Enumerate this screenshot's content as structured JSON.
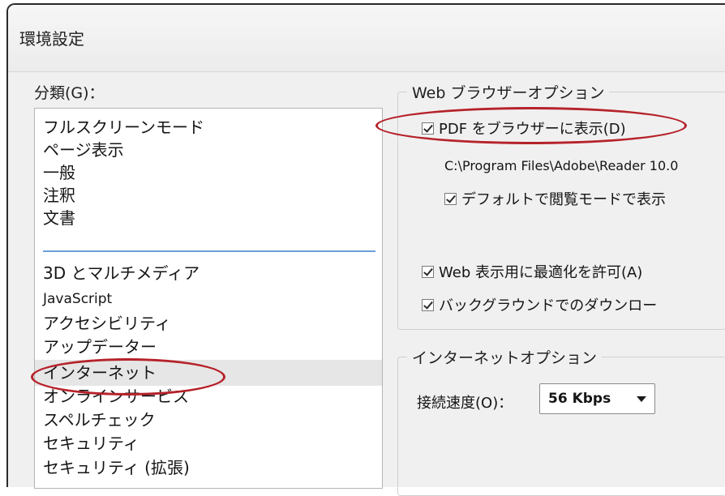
{
  "window": {
    "title": "環境設定"
  },
  "categories": {
    "label": "分類(G)：",
    "top_items": [
      "フルスクリーンモード",
      "ページ表示",
      "一般",
      "注釈",
      "文書"
    ],
    "items": [
      "3D とマルチメディア",
      "JavaScript",
      "アクセシビリティ",
      "アップデーター",
      "インターネット",
      "オンラインサービス",
      "スペルチェック",
      "セキュリティ",
      "セキュリティ (拡張)"
    ],
    "selected": "インターネット"
  },
  "web_browser_options": {
    "title": "Web ブラウザーオプション",
    "display_pdf_in_browser": {
      "label": "PDF をブラウザーに表示(D)",
      "checked": true
    },
    "reader_path": "C:\\Program Files\\Adobe\\Reader 10.0",
    "default_read_mode": {
      "label": "デフォルトで閲覧モードで表示",
      "checked": true
    },
    "allow_fast_web_view": {
      "label": "Web 表示用に最適化を許可(A)",
      "checked": true
    },
    "allow_background_download": {
      "label": "バックグラウンドでのダウンロー",
      "checked": true
    }
  },
  "internet_options": {
    "title": "インターネットオプション",
    "connection_speed": {
      "label": "接続速度(O)：",
      "value": "56 Kbps"
    }
  },
  "colors": {
    "annotation_oval": "#b6222a",
    "separator": "#6b9fd9",
    "selection": "#e6e6e6"
  }
}
